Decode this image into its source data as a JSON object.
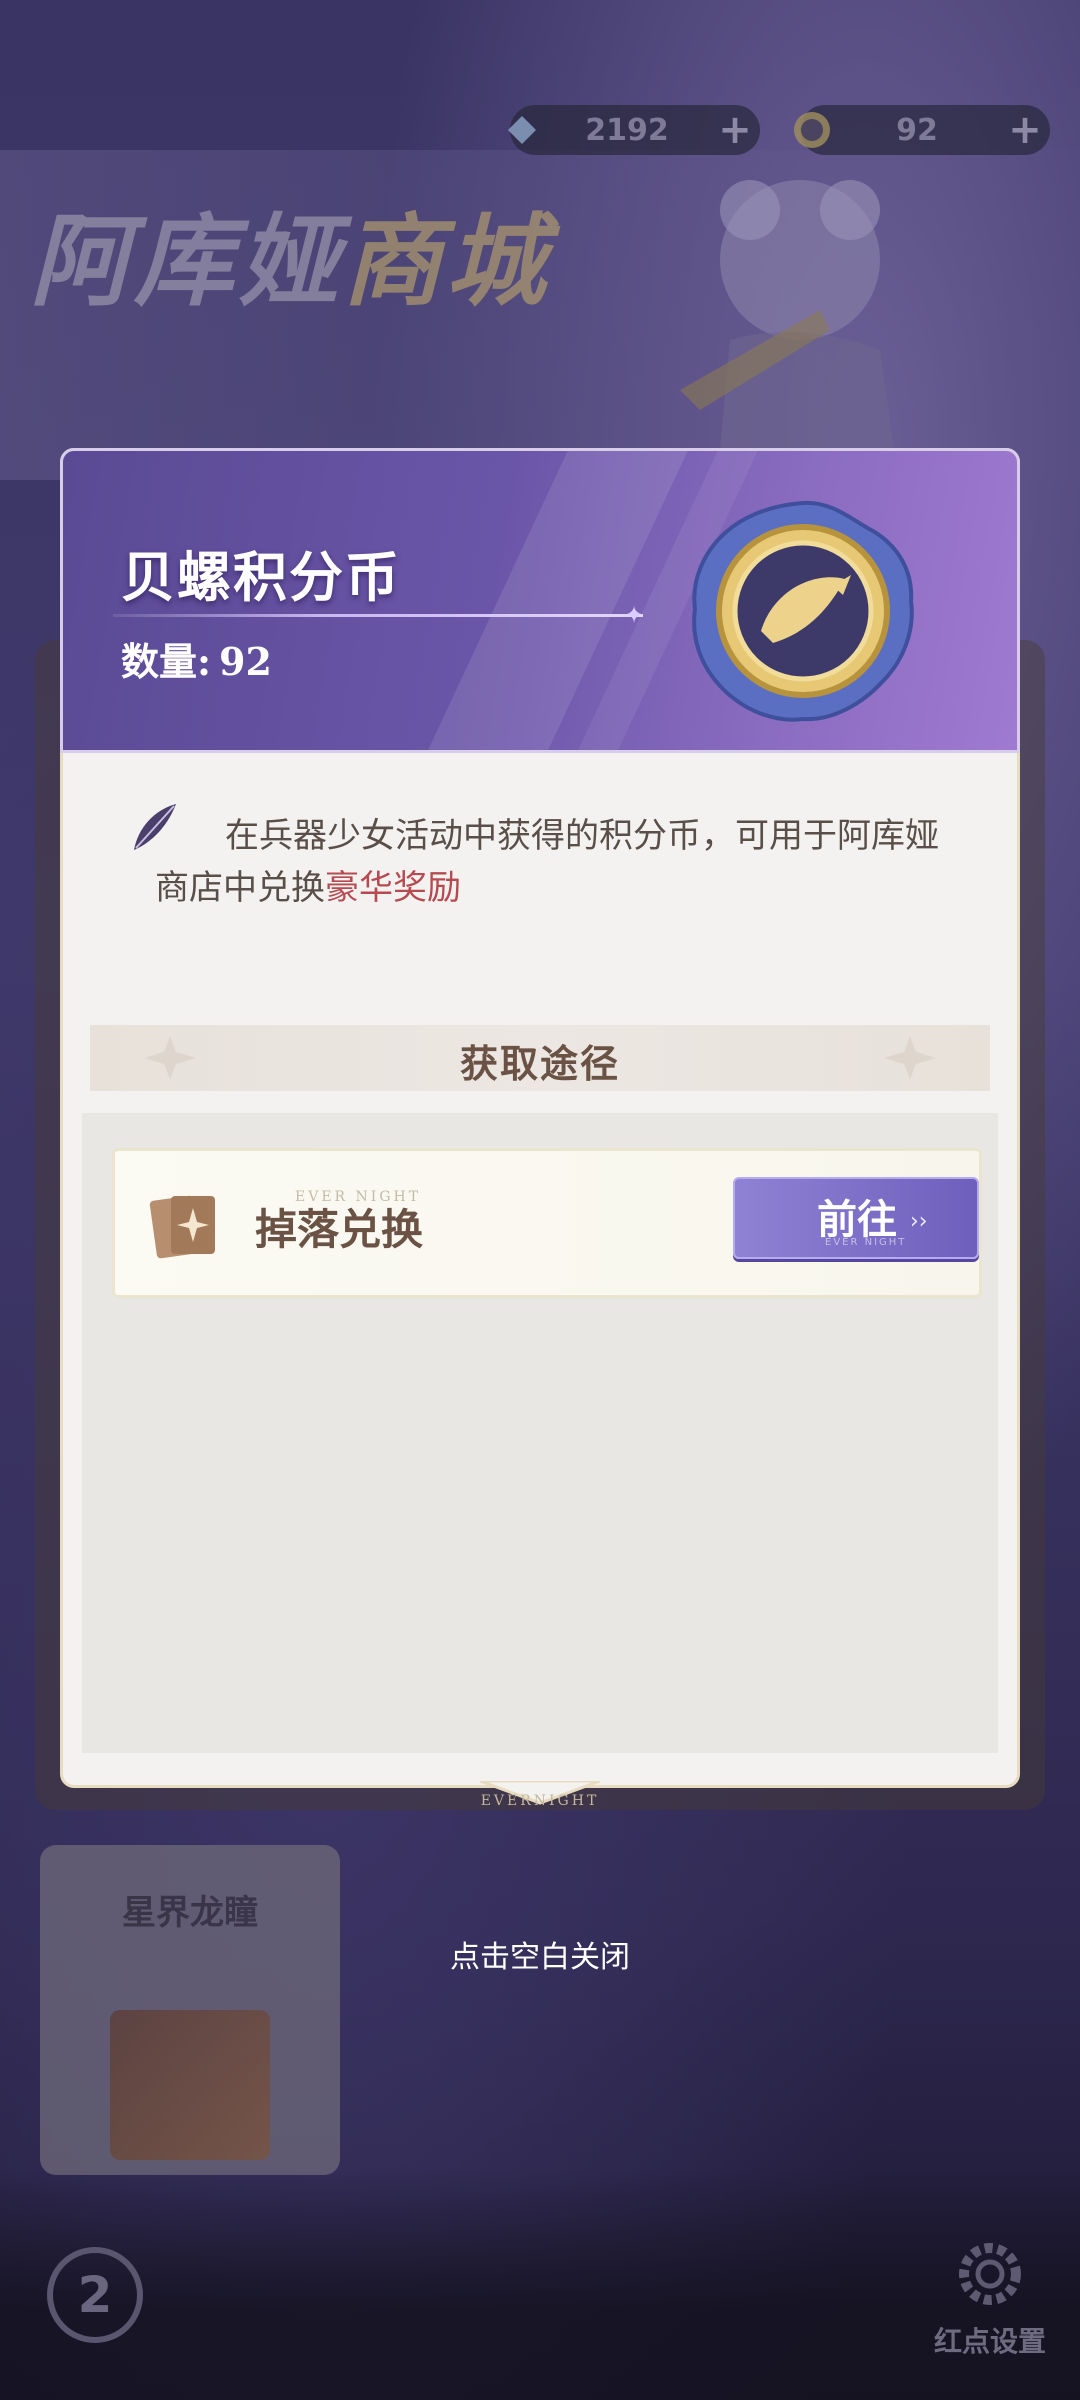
{
  "background": {
    "shop_title_main": "阿库娅",
    "shop_title_accent": "商城",
    "currencies": [
      {
        "icon": "crystal-icon",
        "value": "2192",
        "add": "+"
      },
      {
        "icon": "shell-coin-icon",
        "value": "92",
        "add": "+"
      }
    ],
    "side_tile_title": "星界龙瞳",
    "red_dot_setting": "红点设置"
  },
  "modal": {
    "item_name": "贝螺积分币",
    "count_label": "数量:",
    "count_value": "92",
    "description_main": "在兵器少女活动中获得的积分币，可用于阿库娅商店中兑换",
    "description_highlight": "豪华奖励",
    "section_title": "获取途径",
    "sources": [
      {
        "label": "掉落兑换",
        "button": "前往",
        "icon": "cards-icon"
      }
    ]
  },
  "close_hint": "点击空白关闭",
  "colors": {
    "header_purple": "#6a56a8",
    "highlight_red": "#b74a50",
    "button_purple": "#7a6cc8",
    "text_brown": "#6a5244"
  }
}
